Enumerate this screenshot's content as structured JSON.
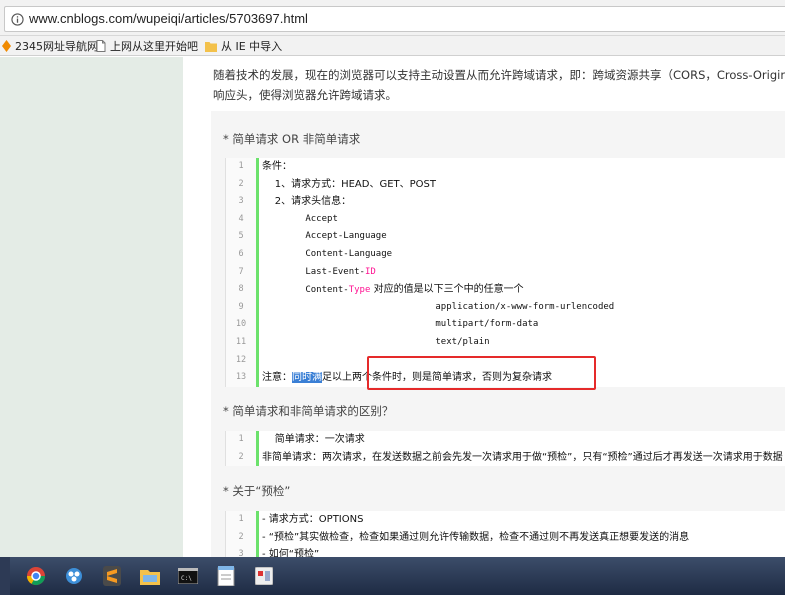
{
  "browser": {
    "url": "www.cnblogs.com/wupeiqi/articles/5703697.html",
    "bookmarks": [
      {
        "label": "2345网址导航网",
        "icon": "orange-logo-icon"
      },
      {
        "label": "上网从这里开始吧",
        "icon": "page-icon"
      },
      {
        "label": "从 IE 中导入",
        "icon": "folder-icon"
      }
    ]
  },
  "article": {
    "intro_line1": "随着技术的发展，现在的浏览器可以支持主动设置从而允许跨域请求，即：跨域资源共享（CORS，Cross-Origin Reso",
    "intro_line2": "响应头，使得浏览器允许跨域请求。",
    "section1_title": "* 简单请求 OR 非简单请求",
    "section2_title": "* 简单请求和非简单请求的区别？",
    "section3_title": "* 关于“预检”",
    "code1": [
      {
        "n": "1",
        "pre": "条件："
      },
      {
        "n": "2",
        "pre": "    1、请求方式：HEAD、GET、POST"
      },
      {
        "n": "3",
        "pre": "    2、请求头信息："
      },
      {
        "n": "4",
        "pre": "        Accept"
      },
      {
        "n": "5",
        "pre": "        Accept-Language"
      },
      {
        "n": "6",
        "pre": "        Content-Language"
      },
      {
        "n": "7",
        "pre": "        Last-Event-",
        "kw": "ID",
        "post": ""
      },
      {
        "n": "8",
        "pre": "        Content-",
        "kw": "Type",
        "post": " 对应的值是以下三个中的任意一个"
      },
      {
        "n": "9",
        "pre": "                                application/x-www-form-urlencoded"
      },
      {
        "n": "10",
        "pre": "                                multipart/form-data"
      },
      {
        "n": "11",
        "pre": "                                text/plain"
      },
      {
        "n": "12",
        "pre": ""
      },
      {
        "n": "13",
        "pre": "注意：",
        "hl": "同时满",
        "post": "足以上两个条件时，则是简单请求，否则为复杂请求"
      }
    ],
    "code2": [
      {
        "n": "1",
        "pre": "    简单请求：一次请求"
      },
      {
        "n": "2",
        "pre": "非简单请求：两次请求，在发送数据之前会先发一次请求用于做“预检”，只有“预检”通过后才再发送一次请求用于数据"
      }
    ],
    "code3": [
      {
        "n": "1",
        "pre": "- 请求方式：OPTIONS"
      },
      {
        "n": "2",
        "pre": "- “预检”其实做检查，检查如果通过则允许传输数据，检查不通过则不再发送真正想要发送的消息"
      },
      {
        "n": "3",
        "pre": "- 如何“预检”"
      }
    ]
  },
  "colors": {
    "highlight_box": "#e52a2a",
    "code_bar": "#6ce26c",
    "keyword": "#ff1493",
    "selection": "#3a7fd5"
  },
  "taskbar": {
    "items": [
      "chrome-icon",
      "network-icon",
      "sublime-icon",
      "explorer-icon",
      "cmd-icon",
      "notepad-icon",
      "app-icon"
    ]
  }
}
